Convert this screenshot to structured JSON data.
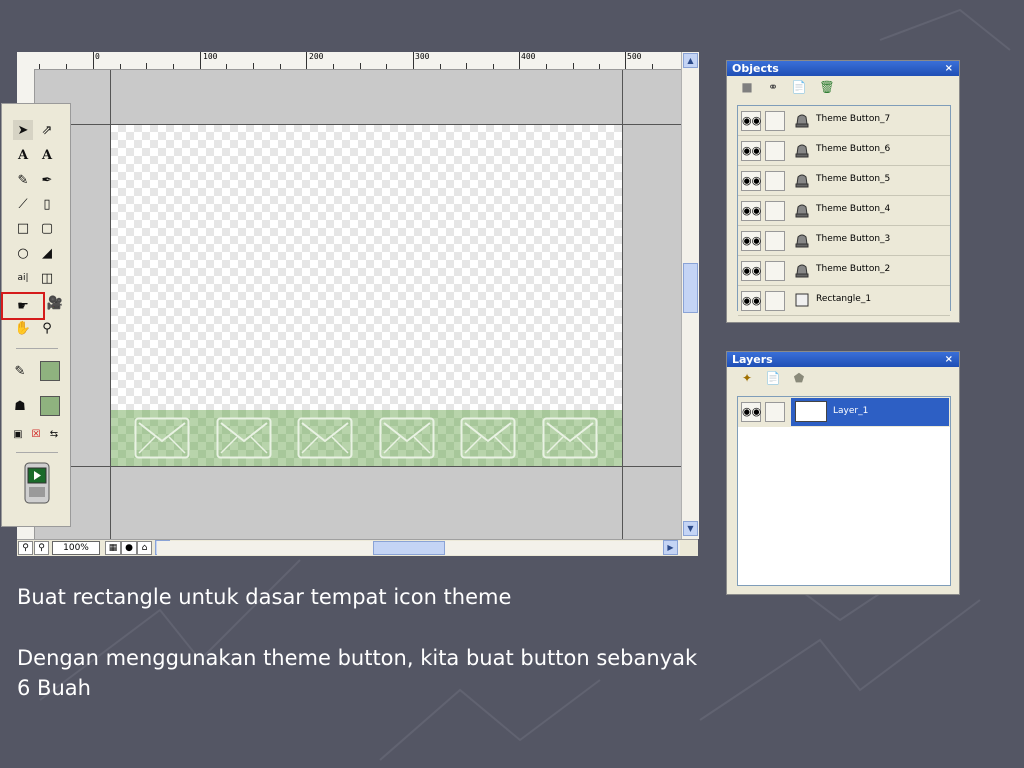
{
  "editor": {
    "ruler_labels": [
      "0",
      "100",
      "200",
      "300",
      "400",
      "500"
    ],
    "zoom": "100%",
    "envelope_count": 6
  },
  "tools": {
    "icons": [
      "pointer-icon",
      "subselect-icon",
      "text-icon",
      "text-path-icon",
      "pencil-icon",
      "pen-icon",
      "line-icon",
      "freeform-icon",
      "rectangle-icon",
      "rounded-rectangle-icon",
      "ellipse-icon",
      "polygon-icon",
      "text-field-icon",
      "image-placeholder-icon",
      "theme-button-icon",
      "movie-icon",
      "hand-icon",
      "zoom-icon"
    ],
    "selected": "theme-button-icon"
  },
  "objects_panel": {
    "title": "Objects",
    "close": "×",
    "items": [
      {
        "label": "Theme Button_7",
        "icon": "theme-button-icon"
      },
      {
        "label": "Theme Button_6",
        "icon": "theme-button-icon"
      },
      {
        "label": "Theme Button_5",
        "icon": "theme-button-icon"
      },
      {
        "label": "Theme Button_4",
        "icon": "theme-button-icon"
      },
      {
        "label": "Theme Button_3",
        "icon": "theme-button-icon"
      },
      {
        "label": "Theme Button_2",
        "icon": "theme-button-icon"
      },
      {
        "label": "Rectangle_1",
        "icon": "rectangle-icon"
      }
    ]
  },
  "layers_panel": {
    "title": "Layers",
    "close": "×",
    "items": [
      {
        "label": "Layer_1",
        "selected": true
      }
    ]
  },
  "captions": {
    "line1": "Buat rectangle untuk dasar tempat icon theme",
    "line2": "Dengan menggunakan theme button, kita buat button sebanyak",
    "line3": "6 Buah"
  },
  "colors": {
    "background": "#545664",
    "accent": "#2d5fc4",
    "rectangle_fill": "#a7c79a",
    "selection_highlight": "#d51b1b"
  }
}
